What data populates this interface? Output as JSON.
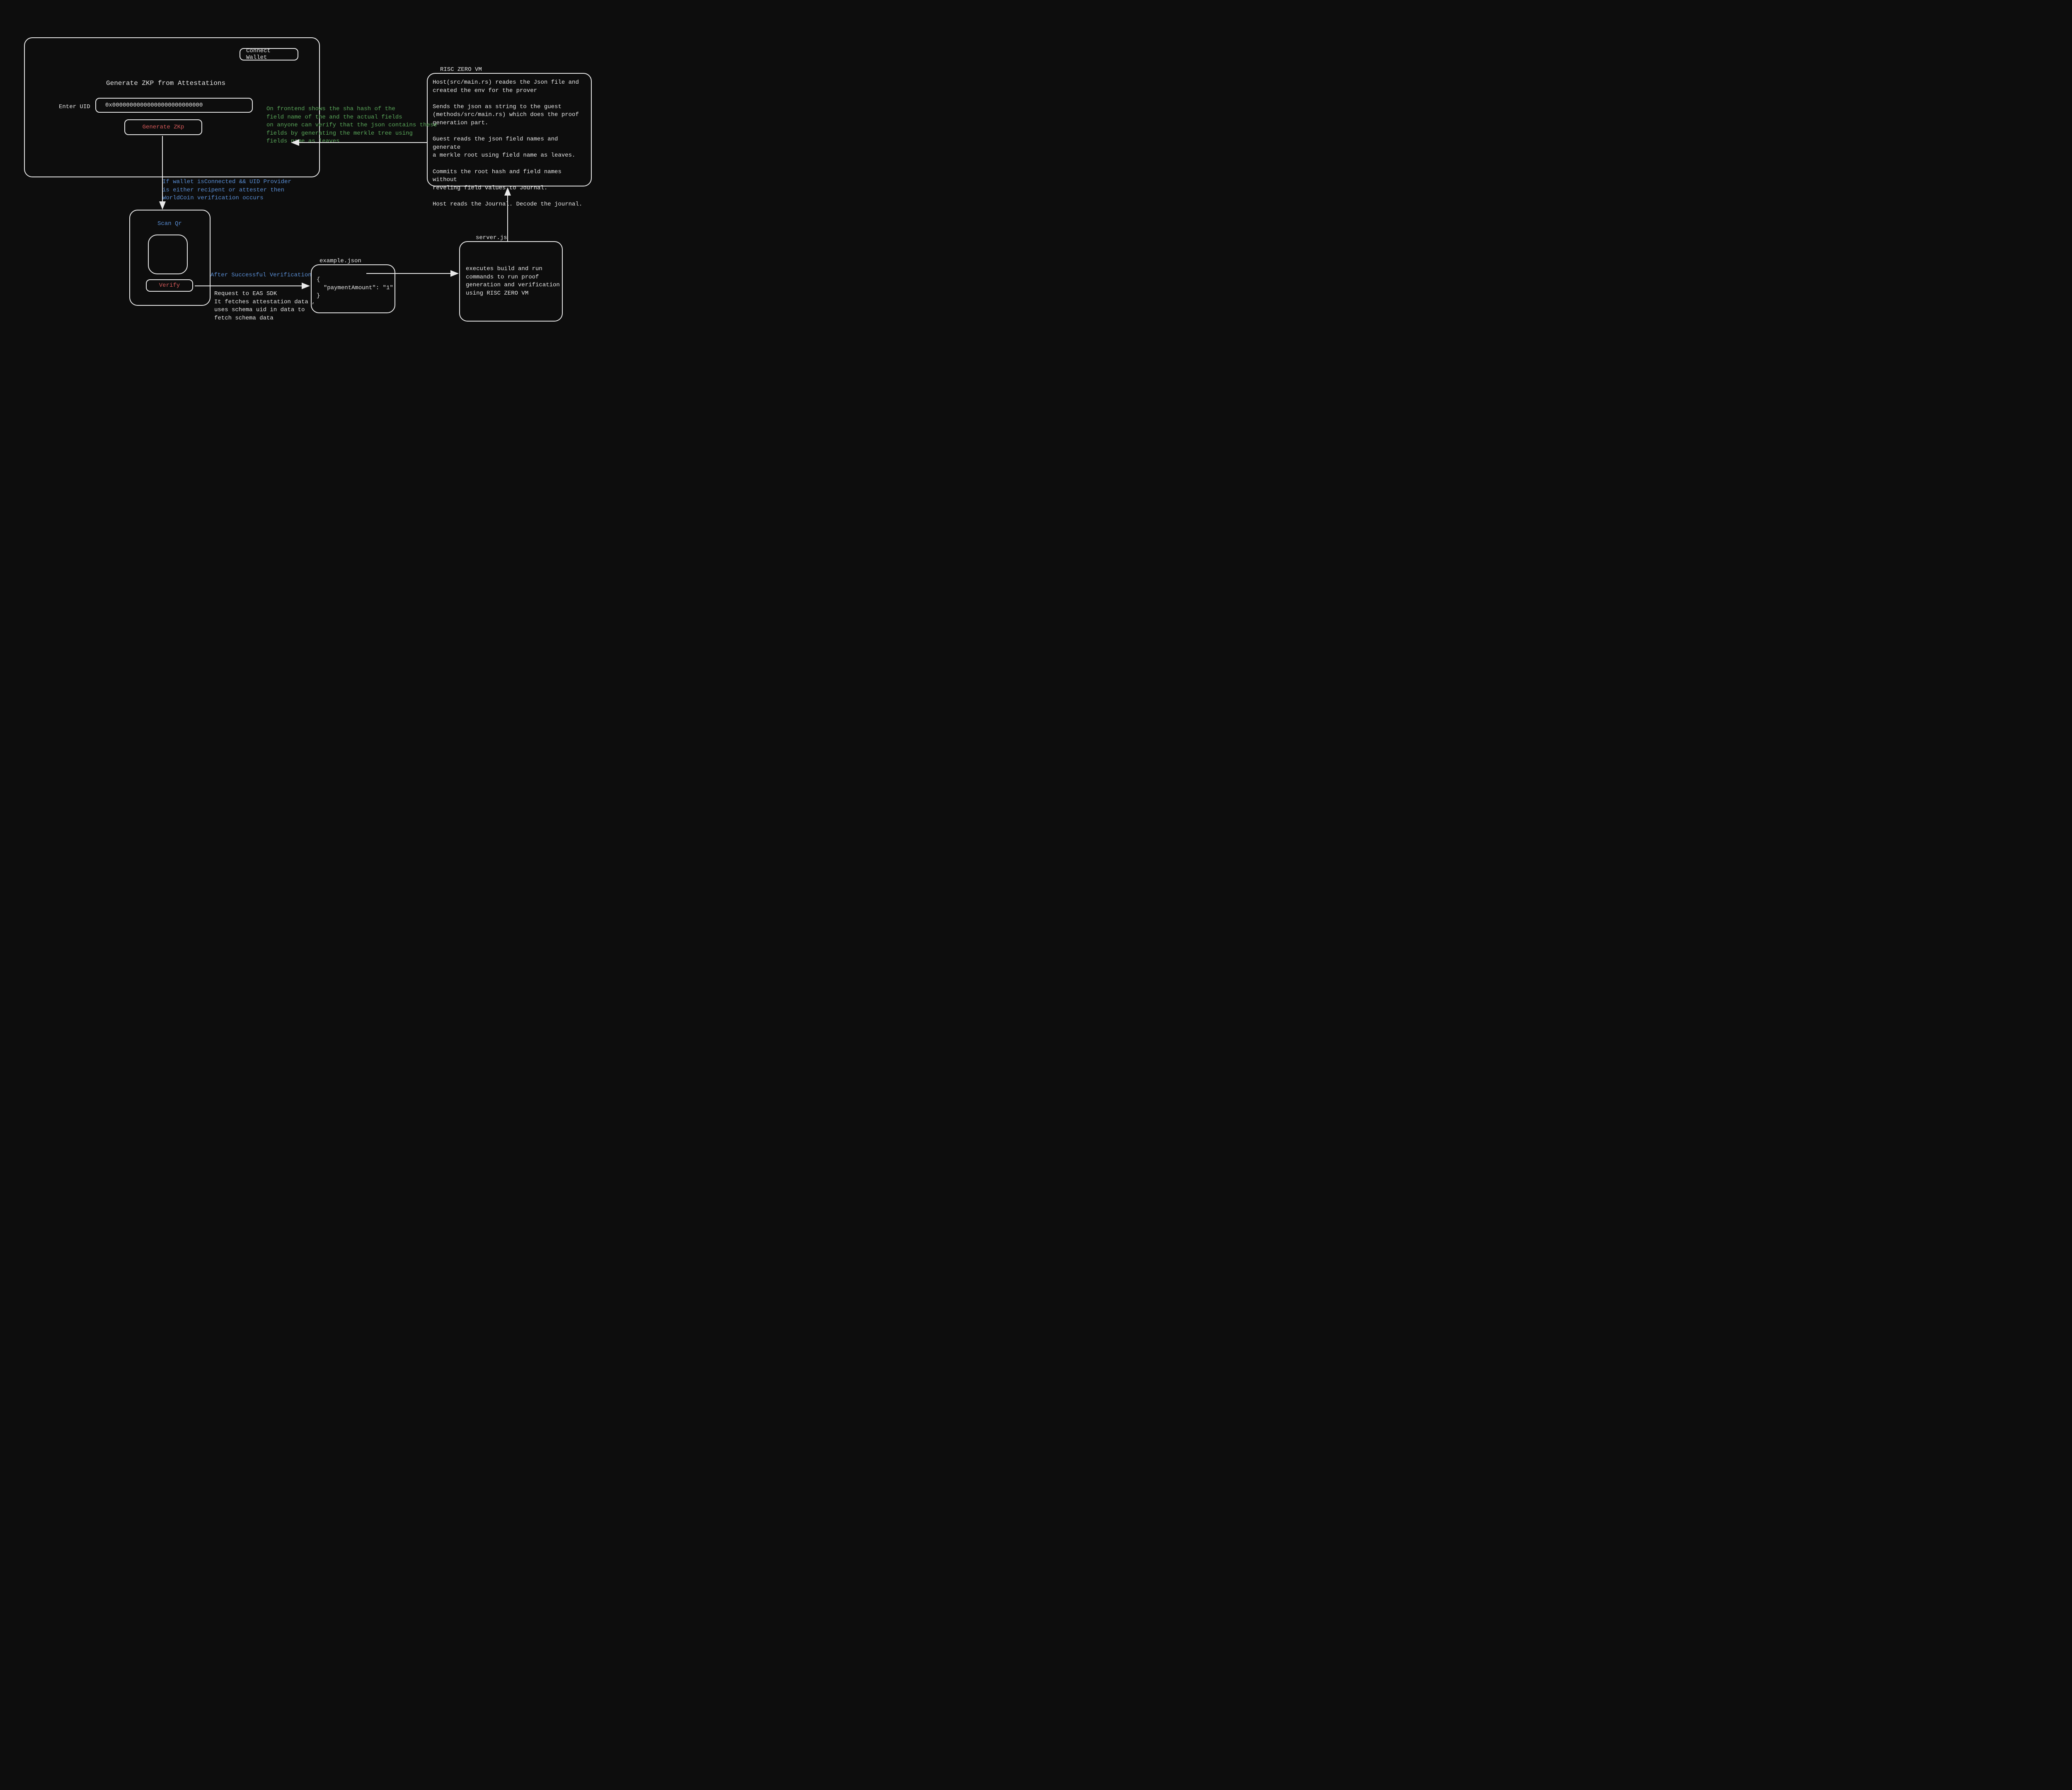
{
  "main_panel": {
    "connect_wallet": "Connect Wallet",
    "title": "Generate ZKP from Attestations",
    "enter_uid_label": "Enter UID",
    "uid_value": "0x00000000000000000000000000",
    "generate_btn": "Generate ZKp"
  },
  "flow": {
    "condition": "If wallet isConnected && UID Provider\nis either recipent or attester then\nWorldCoin verification occurs",
    "after_verification": "After Successful Verification",
    "eas_request": "Request to EAS SDK\nIt fetches attestation data ,\nuses schema uid in data to\nfetch schema data",
    "frontend_note": "On frontend shows the sha hash of the\nfield name of the and the actual fields\non anyone can verify that the json contains these\nfields by generating the merkle tree using\nfields name as leaves"
  },
  "qr_panel": {
    "title": "Scan Qr",
    "verify_btn": "Verify"
  },
  "example_json": {
    "label": "example.json",
    "content": "{\n  \"paymentAmount\": \"1\"\n}"
  },
  "server": {
    "label": "server.js",
    "content": "executes build and run\ncommands to run proof\ngeneration and verification\nusing RISC ZERO VM"
  },
  "risc": {
    "label": "RISC ZERO VM",
    "content": "Host(src/main.rs) reades the Json file and\ncreated the env for the prover\n\nSends the json as string to the guest\n(methods/src/main.rs) which does the proof\ngeneration part.\n\nGuest reads the json field names and generate\na merkle root using field name as leaves.\n\nCommits the root hash and field names without\nreveling field values to Journal.\n\nHost reads the Journal. Decode the journal."
  }
}
